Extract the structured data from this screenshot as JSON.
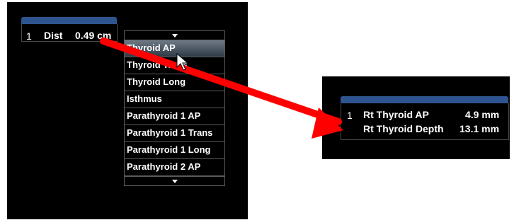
{
  "left_screen": {
    "measurement": {
      "index": "1",
      "label": "Dist",
      "value": "0.49 cm"
    },
    "dropdown": {
      "items": [
        "Thyroid AP",
        "Thyroid Trans",
        "Thyroid Long",
        "Isthmus",
        "Parathyroid 1 AP",
        "Parathyroid 1 Trans",
        "Parathyroid 1 Long",
        "Parathyroid 2 AP"
      ],
      "selected": "Thyroid AP"
    }
  },
  "right_screen": {
    "measurements": [
      {
        "index": "1",
        "label": "Rt Thyroid AP",
        "value": "4.9 mm"
      },
      {
        "index": "",
        "label": "Rt Thyroid Depth",
        "value": "13.1 mm"
      }
    ]
  },
  "colors": {
    "accent_tab": "#2f5590",
    "arrow": "#ff0000",
    "background": "#000000"
  },
  "icons": [
    "dropdown-caret-up-icon",
    "dropdown-caret-down-icon",
    "mouse-cursor-icon",
    "red-arrow"
  ]
}
